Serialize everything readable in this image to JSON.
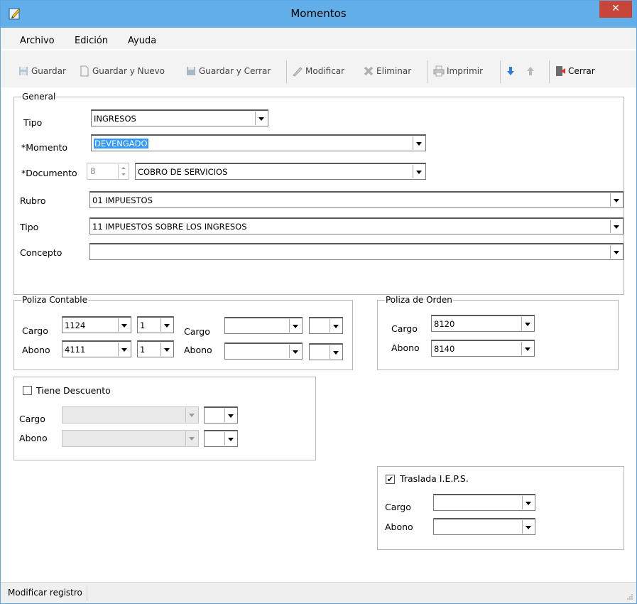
{
  "window": {
    "title": "Momentos",
    "close_glyph": "✕",
    "title_icon": "edit-pencil-icon"
  },
  "menu": {
    "items": [
      "Archivo",
      "Edición",
      "Ayuda"
    ]
  },
  "toolbar": {
    "guardar": "Guardar",
    "guardar_nuevo": "Guardar y Nuevo",
    "guardar_cerrar": "Guardar y Cerrar",
    "modificar": "Modificar",
    "eliminar": "Eliminar",
    "imprimir": "Imprimir",
    "cerrar": "Cerrar"
  },
  "general": {
    "legend": "General",
    "tipo_label": "Tipo",
    "tipo_value": "INGRESOS",
    "momento_label": "*Momento",
    "momento_value": "DEVENGADO",
    "documento_label": "*Documento",
    "documento_number": "8",
    "documento_value": "COBRO DE SERVICIOS",
    "rubro_label": "Rubro",
    "rubro_value": "01 IMPUESTOS",
    "tipo2_label": "Tipo",
    "tipo2_value": "11 IMPUESTOS SOBRE LOS INGRESOS",
    "concepto_label": "Concepto",
    "concepto_value": ""
  },
  "poliza_contable": {
    "legend": "Poliza Contable",
    "cargo_label": "Cargo",
    "abono_label": "Abono",
    "cargo_value": "1124",
    "cargo_sub": "1",
    "abono_value": "4111",
    "abono_sub": "1",
    "cargo2_label": "Cargo",
    "abono2_label": "Abono",
    "cargo2_value": "",
    "cargo2_sub": "",
    "abono2_value": "",
    "abono2_sub": ""
  },
  "poliza_orden": {
    "legend": "Poliza de Orden",
    "cargo_label": "Cargo",
    "cargo_value": "8120",
    "abono_label": "Abono",
    "abono_value": "8140"
  },
  "descuento": {
    "checkbox_label": "Tiene Descuento",
    "checked": false,
    "cargo_label": "Cargo",
    "abono_label": "Abono"
  },
  "ieps": {
    "checkbox_label": "Traslada I.E.P.S.",
    "checked": true,
    "check_glyph": "✔",
    "cargo_label": "Cargo",
    "abono_label": "Abono"
  },
  "status": {
    "text": "Modificar registro"
  },
  "colors": {
    "titlebar": "#62aee8",
    "close": "#c7453a",
    "selection": "#3399ff"
  }
}
